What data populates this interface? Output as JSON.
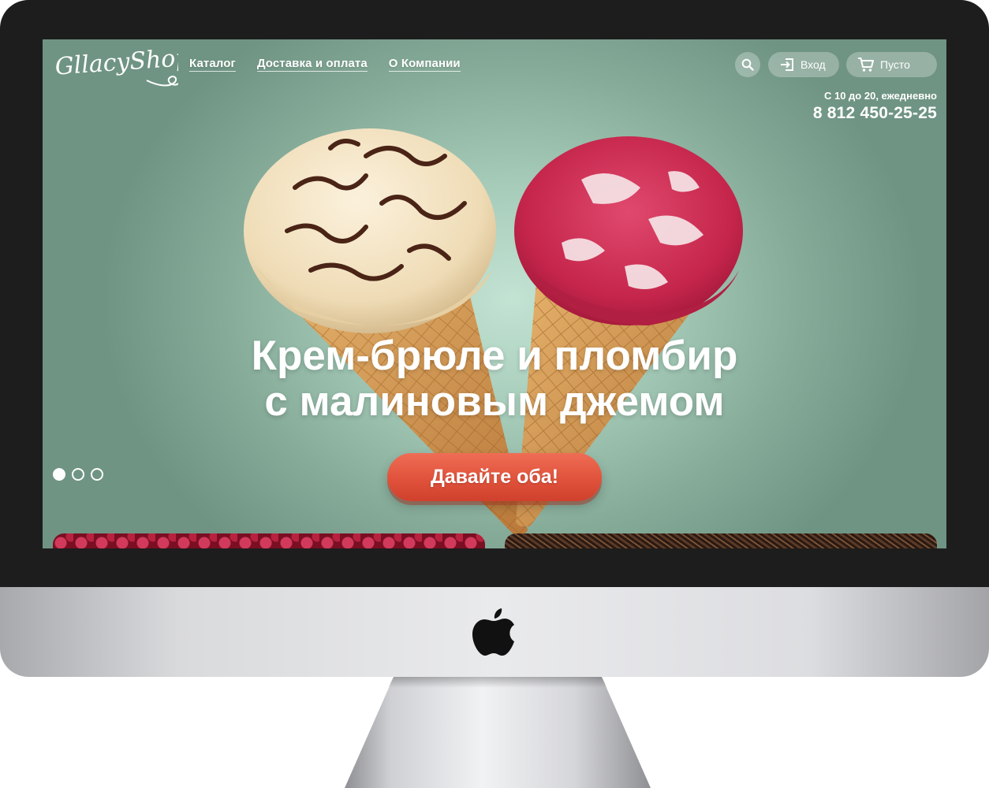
{
  "header": {
    "logo_text": "GllacyShop",
    "nav": [
      {
        "label": "Каталог"
      },
      {
        "label": "Доставка и оплата"
      },
      {
        "label": "О Компании"
      }
    ],
    "login_label": "Вход",
    "cart_label": "Пусто",
    "hours": "С 10 до 20, ежедневно",
    "phone": "8 812 450-25-25"
  },
  "hero": {
    "title_line1": "Крем-брюле и пломбир",
    "title_line2": "с малиновым джемом",
    "cta_label": "Давайте оба!",
    "slides_total": 3,
    "active_slide": 1
  },
  "colors": {
    "background": "#a6cbb9",
    "accent": "#e0523b",
    "text": "#ffffff"
  },
  "icons": [
    "search-icon",
    "login-icon",
    "cart-icon",
    "apple-logo"
  ]
}
